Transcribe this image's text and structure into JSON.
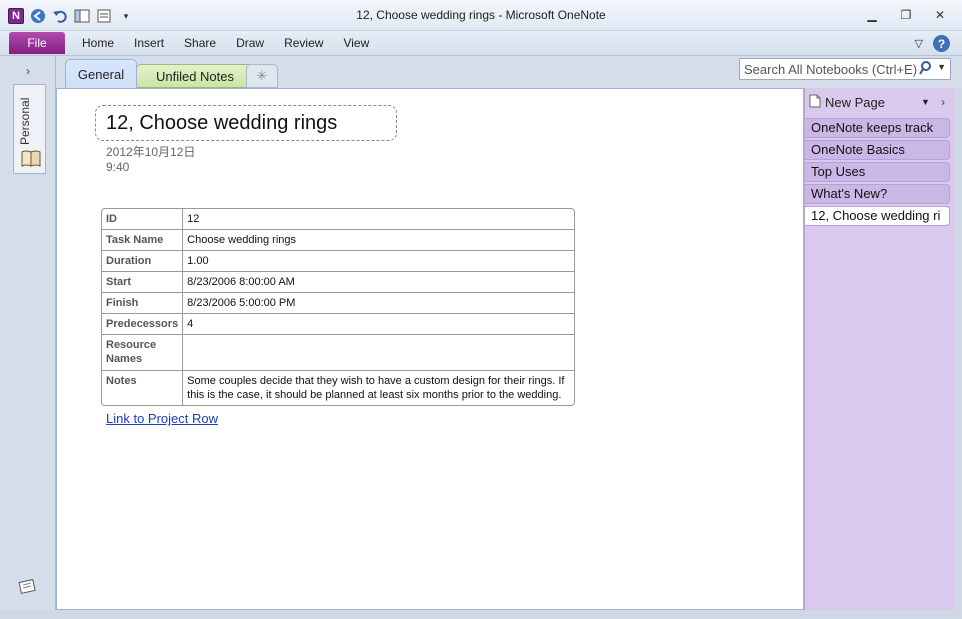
{
  "window": {
    "title": "12, Choose wedding rings  -  Microsoft OneNote",
    "app_logo": "N"
  },
  "ribbon": {
    "file_label": "File",
    "tabs": [
      "Home",
      "Insert",
      "Share",
      "Draw",
      "Review",
      "View"
    ]
  },
  "notebooks": {
    "current": "Personal"
  },
  "sections": {
    "tabs": [
      "General",
      "Unfiled Notes"
    ],
    "active": "General",
    "search_placeholder": "Search All Notebooks (Ctrl+E)"
  },
  "page": {
    "title": "12, Choose wedding rings",
    "date": "2012年10月12日",
    "time": "9:40",
    "table": [
      {
        "key": "ID",
        "value": "12"
      },
      {
        "key": "Task Name",
        "value": "Choose wedding rings"
      },
      {
        "key": "Duration",
        "value": "1.00"
      },
      {
        "key": "Start",
        "value": "8/23/2006 8:00:00 AM"
      },
      {
        "key": "Finish",
        "value": "8/23/2006 5:00:00 PM"
      },
      {
        "key": "Predecessors",
        "value": "4"
      },
      {
        "key": "Resource Names",
        "value": ""
      },
      {
        "key": "Notes",
        "value": "Some couples decide that they wish to have a custom design for their rings. If this is the case, it should be planned at least six months prior to the wedding."
      }
    ],
    "link_text": "Link to Project Row"
  },
  "pages_pane": {
    "new_page_label": "New Page",
    "pages": [
      {
        "label": "OneNote keeps track",
        "selected": false
      },
      {
        "label": "OneNote Basics",
        "selected": false
      },
      {
        "label": "Top Uses",
        "selected": false
      },
      {
        "label": "What's New?",
        "selected": false
      },
      {
        "label": "12, Choose wedding ri",
        "selected": true
      }
    ]
  }
}
